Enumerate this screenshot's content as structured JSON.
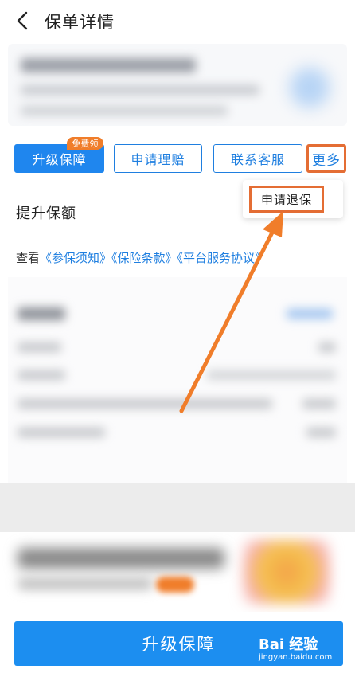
{
  "header": {
    "title": "保单详情",
    "back_icon": "chevron-left-icon"
  },
  "actions": {
    "upgrade_label": "升级保障",
    "free_badge": "免费领",
    "claim_label": "申请理赔",
    "service_label": "联系客服",
    "more_label": "更多"
  },
  "dropdown": {
    "items": [
      {
        "label": "申请退保"
      }
    ]
  },
  "section": {
    "title": "提升保额"
  },
  "terms": {
    "prefix": "查看",
    "links": [
      "《参保须知》",
      "《保险条款》",
      "《平台服务协议》"
    ]
  },
  "bottom": {
    "cta_label": "升级保障"
  },
  "watermark": {
    "brand": "Bai 经验",
    "sub": "jingyan.baidu.com"
  },
  "colors": {
    "accent": "#1f7fe0",
    "cta": "#1c8ef0",
    "highlight": "#e46d34",
    "badge": "#f07d2a"
  }
}
